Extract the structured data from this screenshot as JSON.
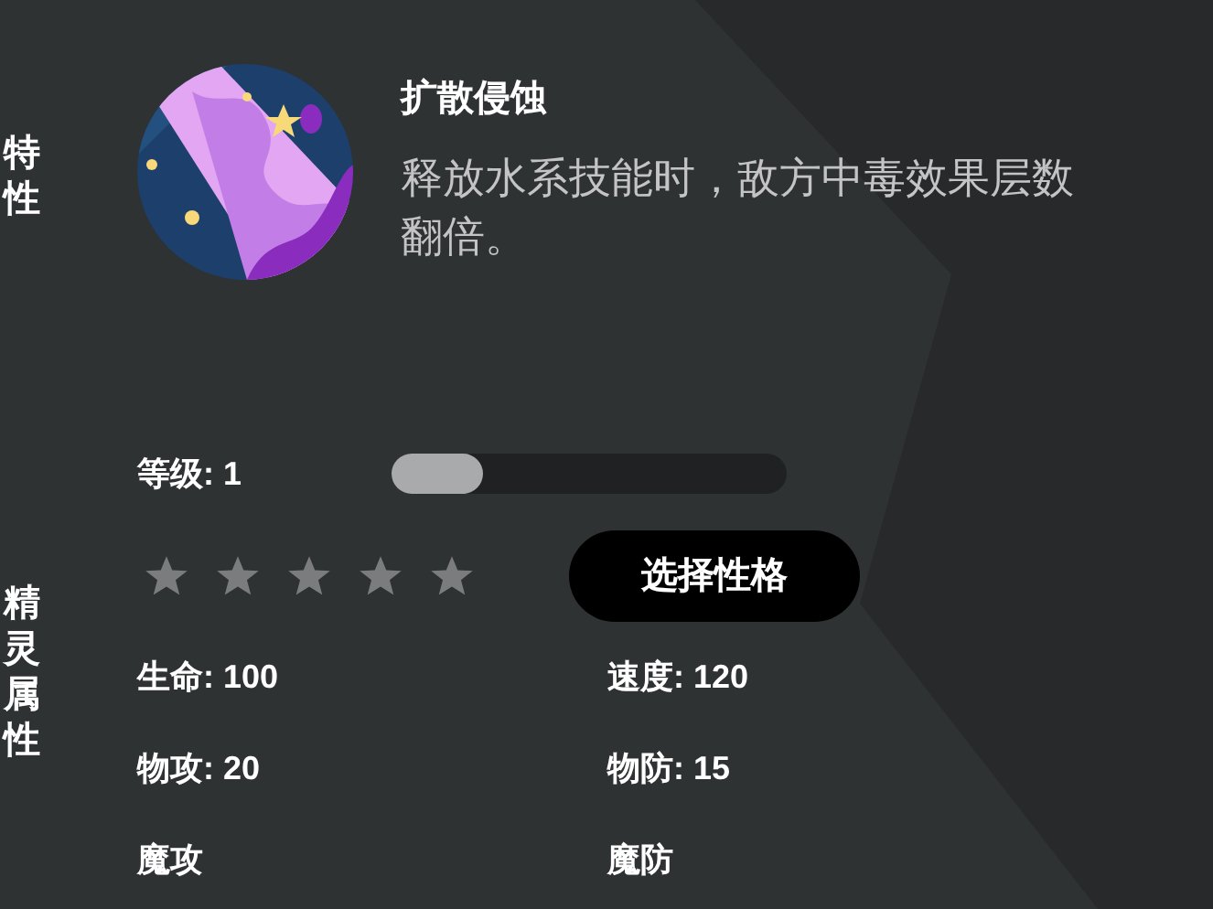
{
  "side_labels": [
    "特性",
    "精灵属性"
  ],
  "trait": {
    "title": "扩散侵蚀",
    "description": "释放水系技能时，敌方中毒效果层数翻倍。"
  },
  "level": {
    "label": "等级: 1",
    "level": 0.23
  },
  "rating": {
    "stars": 0
  },
  "nature_button": "选择性格",
  "stats": [
    {
      "label": "生命: 100"
    },
    {
      "label": "速度: 120"
    },
    {
      "label": "物攻: 20"
    },
    {
      "label": "物防: 15"
    },
    {
      "label": "魔攻"
    },
    {
      "label": "魔防"
    }
  ]
}
